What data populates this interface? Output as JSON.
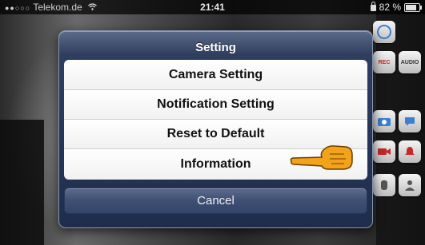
{
  "status_bar": {
    "carrier": "Telekom.de",
    "time": "21:41",
    "battery": "82 %",
    "battery_level": 0.82
  },
  "dialog": {
    "title": "Setting",
    "options": [
      {
        "label": "Camera Setting"
      },
      {
        "label": "Notification Setting"
      },
      {
        "label": "Reset to Default"
      },
      {
        "label": "Information"
      }
    ],
    "cancel_label": "Cancel"
  },
  "side_icons": [
    {
      "name": "settings-icon",
      "text": ""
    },
    {
      "name": "record-icon",
      "text": "REC"
    },
    {
      "name": "audio-icon",
      "text": "AUDIO"
    },
    {
      "name": "snapshot-icon",
      "text": ""
    },
    {
      "name": "talk-icon",
      "text": ""
    },
    {
      "name": "video-icon",
      "text": ""
    },
    {
      "name": "alarm-icon",
      "text": ""
    }
  ],
  "colors": {
    "dialog_bg": "#1f2d4c",
    "option_bg": "#ffffff",
    "hand_color": "#f2a21b"
  }
}
